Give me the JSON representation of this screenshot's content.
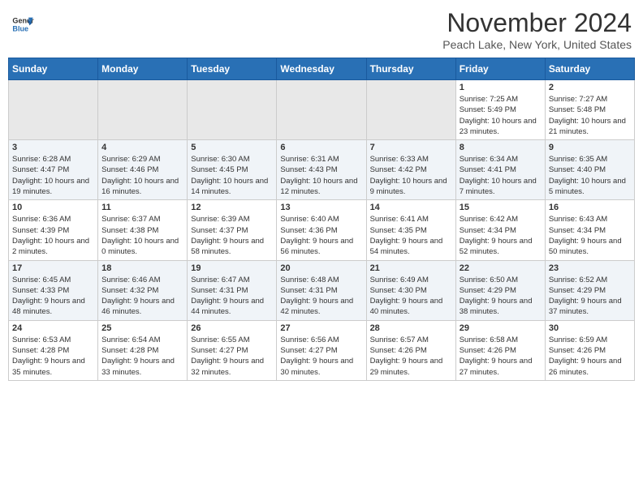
{
  "header": {
    "logo_line1": "General",
    "logo_line2": "Blue",
    "month_title": "November 2024",
    "subtitle": "Peach Lake, New York, United States"
  },
  "days_of_week": [
    "Sunday",
    "Monday",
    "Tuesday",
    "Wednesday",
    "Thursday",
    "Friday",
    "Saturday"
  ],
  "weeks": [
    [
      {
        "day": "",
        "info": ""
      },
      {
        "day": "",
        "info": ""
      },
      {
        "day": "",
        "info": ""
      },
      {
        "day": "",
        "info": ""
      },
      {
        "day": "",
        "info": ""
      },
      {
        "day": "1",
        "info": "Sunrise: 7:25 AM\nSunset: 5:49 PM\nDaylight: 10 hours and 23 minutes."
      },
      {
        "day": "2",
        "info": "Sunrise: 7:27 AM\nSunset: 5:48 PM\nDaylight: 10 hours and 21 minutes."
      }
    ],
    [
      {
        "day": "3",
        "info": "Sunrise: 6:28 AM\nSunset: 4:47 PM\nDaylight: 10 hours and 19 minutes."
      },
      {
        "day": "4",
        "info": "Sunrise: 6:29 AM\nSunset: 4:46 PM\nDaylight: 10 hours and 16 minutes."
      },
      {
        "day": "5",
        "info": "Sunrise: 6:30 AM\nSunset: 4:45 PM\nDaylight: 10 hours and 14 minutes."
      },
      {
        "day": "6",
        "info": "Sunrise: 6:31 AM\nSunset: 4:43 PM\nDaylight: 10 hours and 12 minutes."
      },
      {
        "day": "7",
        "info": "Sunrise: 6:33 AM\nSunset: 4:42 PM\nDaylight: 10 hours and 9 minutes."
      },
      {
        "day": "8",
        "info": "Sunrise: 6:34 AM\nSunset: 4:41 PM\nDaylight: 10 hours and 7 minutes."
      },
      {
        "day": "9",
        "info": "Sunrise: 6:35 AM\nSunset: 4:40 PM\nDaylight: 10 hours and 5 minutes."
      }
    ],
    [
      {
        "day": "10",
        "info": "Sunrise: 6:36 AM\nSunset: 4:39 PM\nDaylight: 10 hours and 2 minutes."
      },
      {
        "day": "11",
        "info": "Sunrise: 6:37 AM\nSunset: 4:38 PM\nDaylight: 10 hours and 0 minutes."
      },
      {
        "day": "12",
        "info": "Sunrise: 6:39 AM\nSunset: 4:37 PM\nDaylight: 9 hours and 58 minutes."
      },
      {
        "day": "13",
        "info": "Sunrise: 6:40 AM\nSunset: 4:36 PM\nDaylight: 9 hours and 56 minutes."
      },
      {
        "day": "14",
        "info": "Sunrise: 6:41 AM\nSunset: 4:35 PM\nDaylight: 9 hours and 54 minutes."
      },
      {
        "day": "15",
        "info": "Sunrise: 6:42 AM\nSunset: 4:34 PM\nDaylight: 9 hours and 52 minutes."
      },
      {
        "day": "16",
        "info": "Sunrise: 6:43 AM\nSunset: 4:34 PM\nDaylight: 9 hours and 50 minutes."
      }
    ],
    [
      {
        "day": "17",
        "info": "Sunrise: 6:45 AM\nSunset: 4:33 PM\nDaylight: 9 hours and 48 minutes."
      },
      {
        "day": "18",
        "info": "Sunrise: 6:46 AM\nSunset: 4:32 PM\nDaylight: 9 hours and 46 minutes."
      },
      {
        "day": "19",
        "info": "Sunrise: 6:47 AM\nSunset: 4:31 PM\nDaylight: 9 hours and 44 minutes."
      },
      {
        "day": "20",
        "info": "Sunrise: 6:48 AM\nSunset: 4:31 PM\nDaylight: 9 hours and 42 minutes."
      },
      {
        "day": "21",
        "info": "Sunrise: 6:49 AM\nSunset: 4:30 PM\nDaylight: 9 hours and 40 minutes."
      },
      {
        "day": "22",
        "info": "Sunrise: 6:50 AM\nSunset: 4:29 PM\nDaylight: 9 hours and 38 minutes."
      },
      {
        "day": "23",
        "info": "Sunrise: 6:52 AM\nSunset: 4:29 PM\nDaylight: 9 hours and 37 minutes."
      }
    ],
    [
      {
        "day": "24",
        "info": "Sunrise: 6:53 AM\nSunset: 4:28 PM\nDaylight: 9 hours and 35 minutes."
      },
      {
        "day": "25",
        "info": "Sunrise: 6:54 AM\nSunset: 4:28 PM\nDaylight: 9 hours and 33 minutes."
      },
      {
        "day": "26",
        "info": "Sunrise: 6:55 AM\nSunset: 4:27 PM\nDaylight: 9 hours and 32 minutes."
      },
      {
        "day": "27",
        "info": "Sunrise: 6:56 AM\nSunset: 4:27 PM\nDaylight: 9 hours and 30 minutes."
      },
      {
        "day": "28",
        "info": "Sunrise: 6:57 AM\nSunset: 4:26 PM\nDaylight: 9 hours and 29 minutes."
      },
      {
        "day": "29",
        "info": "Sunrise: 6:58 AM\nSunset: 4:26 PM\nDaylight: 9 hours and 27 minutes."
      },
      {
        "day": "30",
        "info": "Sunrise: 6:59 AM\nSunset: 4:26 PM\nDaylight: 9 hours and 26 minutes."
      }
    ]
  ]
}
